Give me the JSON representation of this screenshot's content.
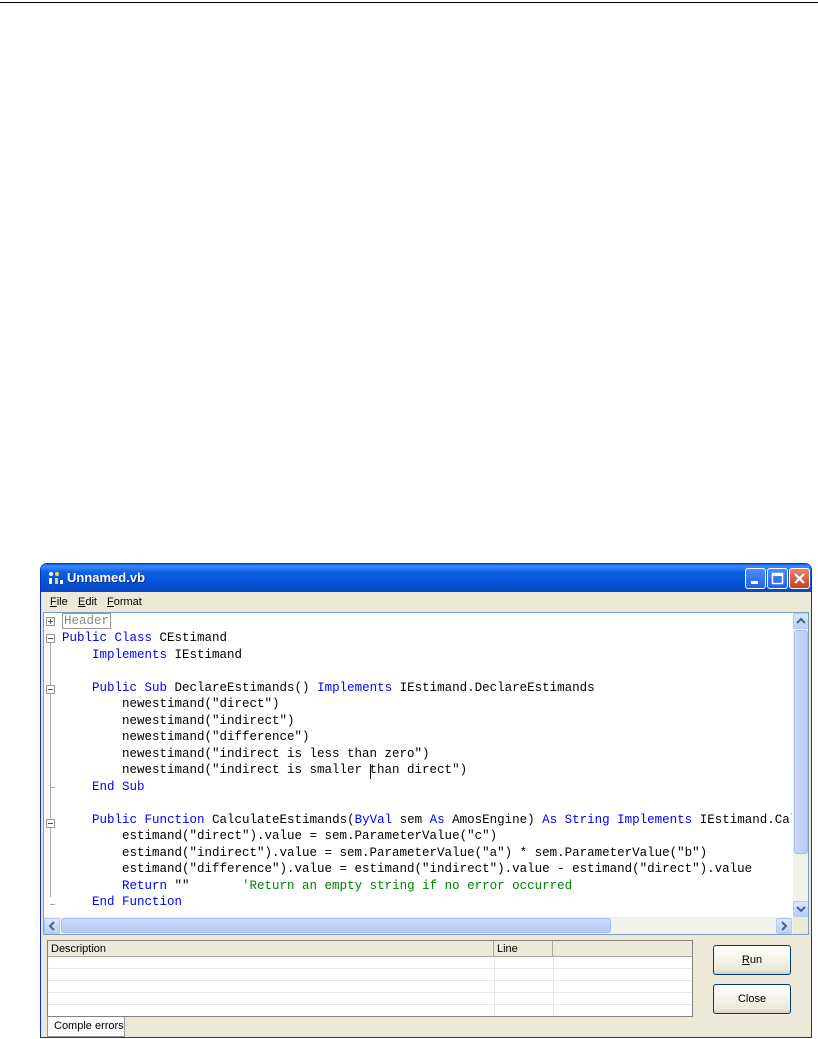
{
  "window": {
    "title": "Unnamed.vb"
  },
  "menu": {
    "file_first": "F",
    "file_rest": "ile",
    "edit_first": "E",
    "edit_rest": "dit",
    "format_first": "F",
    "format_rest": "ormat"
  },
  "code": {
    "header": "Header",
    "lines": [
      [
        {
          "t": "Public Class",
          "k": "kw"
        },
        {
          "t": " CEstimand",
          "k": ""
        }
      ],
      [
        {
          "t": "    ",
          "k": ""
        },
        {
          "t": "Implements",
          "k": "kw"
        },
        {
          "t": " IEstimand",
          "k": ""
        }
      ],
      [],
      [
        {
          "t": "    ",
          "k": ""
        },
        {
          "t": "Public Sub",
          "k": "kw"
        },
        {
          "t": " DeclareEstimands() ",
          "k": ""
        },
        {
          "t": "Implements",
          "k": "kw"
        },
        {
          "t": " IEstimand.DeclareEstimands",
          "k": ""
        }
      ],
      [
        {
          "t": "        newestimand(\"direct\")",
          "k": ""
        }
      ],
      [
        {
          "t": "        newestimand(\"indirect\")",
          "k": ""
        }
      ],
      [
        {
          "t": "        newestimand(\"difference\")",
          "k": ""
        }
      ],
      [
        {
          "t": "        newestimand(\"indirect is less than zero\")",
          "k": ""
        }
      ],
      [
        {
          "t": "        newestimand(\"indirect is smaller than direct\")",
          "k": ""
        }
      ],
      [
        {
          "t": "    ",
          "k": ""
        },
        {
          "t": "End Sub",
          "k": "kw"
        }
      ],
      [],
      [
        {
          "t": "    ",
          "k": ""
        },
        {
          "t": "Public Function",
          "k": "kw"
        },
        {
          "t": " CalculateEstimands(",
          "k": ""
        },
        {
          "t": "ByVal",
          "k": "kw"
        },
        {
          "t": " sem ",
          "k": ""
        },
        {
          "t": "As",
          "k": "kw"
        },
        {
          "t": " AmosEngine) ",
          "k": ""
        },
        {
          "t": "As String Implements",
          "k": "kw"
        },
        {
          "t": " IEstimand.CalculateEstimands",
          "k": ""
        }
      ],
      [
        {
          "t": "        estimand(\"direct\").value = sem.ParameterValue(\"c\")",
          "k": ""
        }
      ],
      [
        {
          "t": "        estimand(\"indirect\").value = sem.ParameterValue(\"a\") * sem.ParameterValue(\"b\")",
          "k": ""
        }
      ],
      [
        {
          "t": "        estimand(\"difference\").value = estimand(\"indirect\").value - estimand(\"direct\").value",
          "k": ""
        }
      ],
      [
        {
          "t": "        ",
          "k": ""
        },
        {
          "t": "Return",
          "k": "kw"
        },
        {
          "t": " \"\"       ",
          "k": ""
        },
        {
          "t": "'Return an empty string if no error occurred",
          "k": "cm"
        }
      ],
      [
        {
          "t": "    ",
          "k": ""
        },
        {
          "t": "End Function",
          "k": "kw"
        }
      ]
    ]
  },
  "errors": {
    "col_description": "Description",
    "col_line": "Line",
    "tab_label": "Comple errors"
  },
  "buttons": {
    "run_first": "R",
    "run_rest": "un",
    "close": "Close"
  }
}
